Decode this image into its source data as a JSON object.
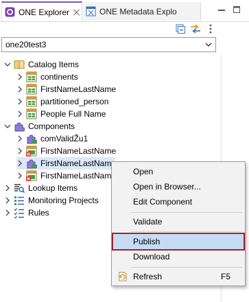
{
  "tabs": [
    {
      "label": "ONE Explorer",
      "active": true
    },
    {
      "label": "ONE Metadata Explo",
      "active": false
    }
  ],
  "project_selector": {
    "value": "one20test3"
  },
  "tree": {
    "catalog_items": {
      "label": "Catalog Items",
      "children": [
        "continents",
        "FirstNameLastName",
        "partitioned_person",
        "People Full Name"
      ]
    },
    "components": {
      "label": "Components",
      "children": [
        "comValidŽu1",
        "FirstNameLastName",
        "FirstNameLastNam",
        "FirstNameLastNam"
      ]
    },
    "lookup_items": {
      "label": "Lookup Items"
    },
    "monitoring_projects": {
      "label": "Monitoring Projects"
    },
    "rules": {
      "label": "Rules"
    }
  },
  "context_menu": {
    "open": "Open",
    "open_in_browser": "Open in Browser...",
    "edit_component": "Edit Component",
    "validate": "Validate",
    "publish": "Publish",
    "download": "Download",
    "refresh": "Refresh",
    "refresh_shortcut": "F5"
  },
  "colors": {
    "accent_tab": "#7d57b5",
    "selection": "#dbe8f9",
    "menu_highlight": "#c6dcf4",
    "highlight_border": "#a6202a"
  }
}
